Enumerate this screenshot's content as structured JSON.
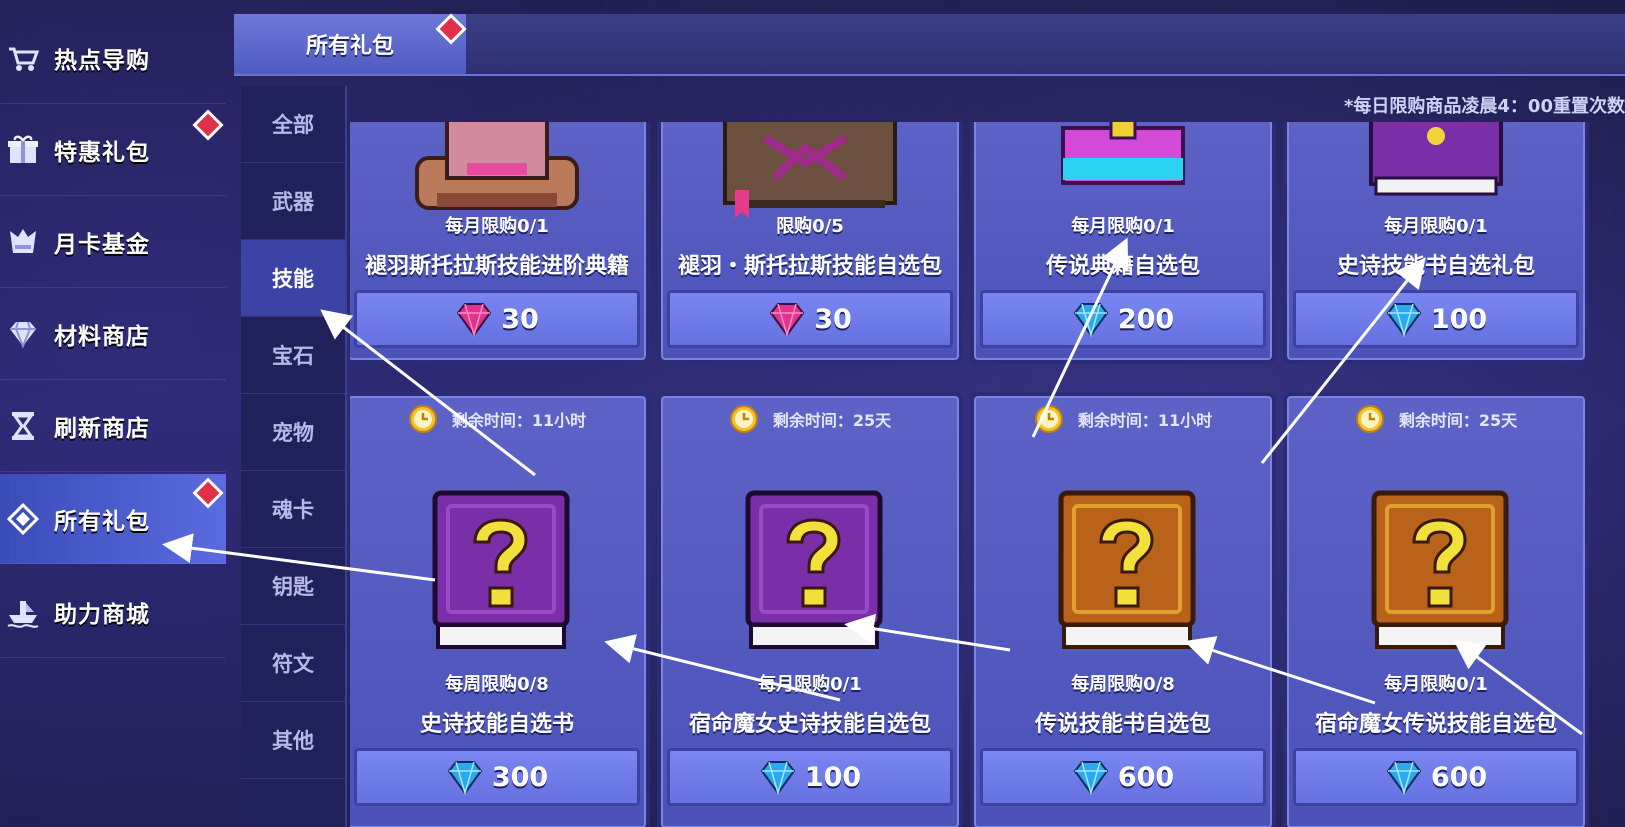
{
  "sidebar": {
    "items": [
      {
        "label": "热点导购",
        "icon": "cart-icon"
      },
      {
        "label": "特惠礼包",
        "icon": "gift-icon"
      },
      {
        "label": "月卡基金",
        "icon": "calendar-icon"
      },
      {
        "label": "材料商店",
        "icon": "gem-icon"
      },
      {
        "label": "刷新商店",
        "icon": "hourglass-icon"
      },
      {
        "label": "所有礼包",
        "icon": "diamond-icon",
        "active": true
      },
      {
        "label": "助力商城",
        "icon": "ship-icon"
      }
    ]
  },
  "tabs": {
    "active": "所有礼包"
  },
  "notice": "*每日限购商品凌晨4：00重置次数",
  "subcategories": [
    "全部",
    "武器",
    "技能",
    "宝石",
    "宠物",
    "魂卡",
    "钥匙",
    "符文",
    "其他"
  ],
  "active_subcategory": "技能",
  "products_top": [
    {
      "limit": "每月限购0/1",
      "name": "褪羽斯托拉斯技能进阶典籍",
      "currency": "pink-gem",
      "price": "30"
    },
    {
      "limit": "限购0/5",
      "name": "褪羽・斯托拉斯技能自选包",
      "currency": "pink-gem",
      "price": "30"
    },
    {
      "limit": "每月限购0/1",
      "name": "传说典籍自选包",
      "currency": "blue-gem",
      "price": "200"
    },
    {
      "limit": "每月限购0/1",
      "name": "史诗技能书自选礼包",
      "currency": "blue-gem",
      "price": "100"
    }
  ],
  "products_bottom": [
    {
      "timer": "剩余时间：11小时",
      "limit": "每周限购0/8",
      "name": "史诗技能自选书",
      "price": "300",
      "book": "purple"
    },
    {
      "timer": "剩余时间：25天",
      "limit": "每月限购0/1",
      "name": "宿命魔女史诗技能自选包",
      "price": "100",
      "book": "purple"
    },
    {
      "timer": "剩余时间：11小时",
      "limit": "每周限购0/8",
      "name": "传说技能书自选包",
      "price": "600",
      "book": "gold"
    },
    {
      "timer": "剩余时间：25天",
      "limit": "每月限购0/1",
      "name": "宿命魔女传说技能自选包",
      "price": "600",
      "book": "gold"
    }
  ],
  "colors": {
    "purple_book": "#7a2fa8",
    "gold_book": "#b8621a",
    "pink_gem": "#e2348c",
    "blue_gem": "#2aa9ef",
    "active_nav": "#4a5bd0"
  }
}
